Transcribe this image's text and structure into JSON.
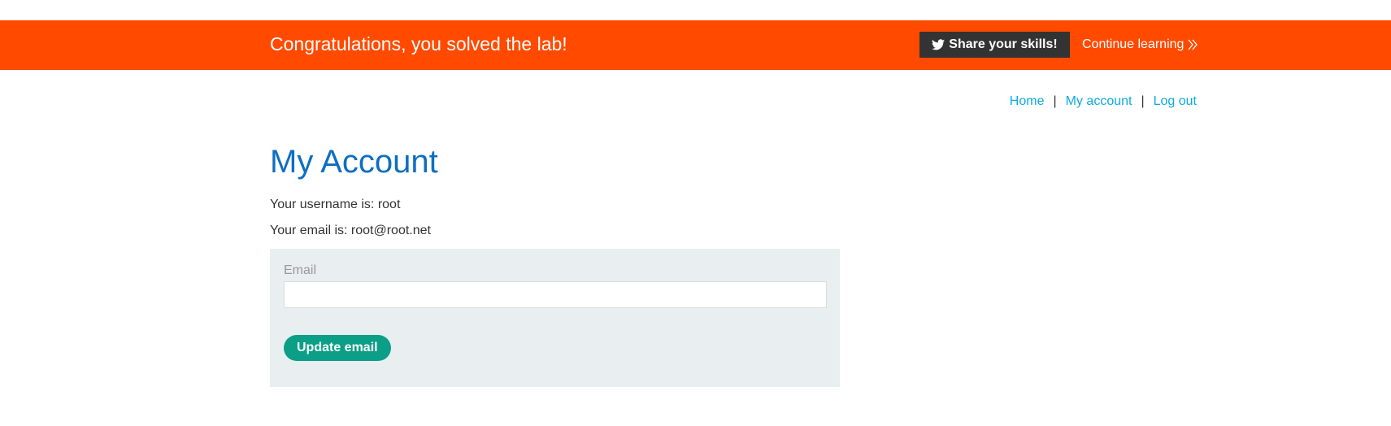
{
  "banner": {
    "title": "Congratulations, you solved the lab!",
    "share_label": "Share your skills!",
    "share_icon": "twitter-bird-icon",
    "continue_label": "Continue learning",
    "continue_icon": "double-chevron-right-icon",
    "background_color": "#ff4a00"
  },
  "nav": {
    "items": [
      {
        "label": "Home"
      },
      {
        "label": "My account"
      },
      {
        "label": "Log out"
      }
    ],
    "separator": "|",
    "link_color": "#0cabe0"
  },
  "main": {
    "title": "My Account",
    "username_line": "Your username is: root",
    "email_line": "Your email is: root@root.net",
    "form": {
      "email_label": "Email",
      "email_value": "",
      "submit_label": "Update email",
      "button_color": "#0a9f86"
    }
  }
}
